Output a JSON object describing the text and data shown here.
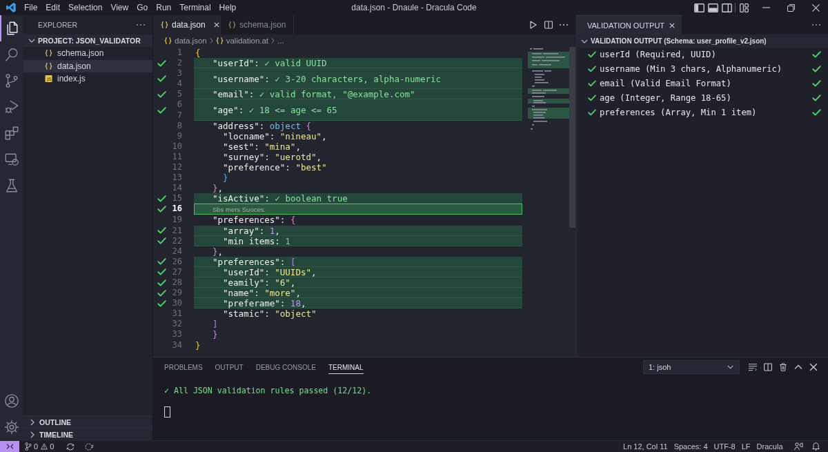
{
  "window": {
    "title": "data.json - Dnaule - Dracula Code"
  },
  "menu": [
    "File",
    "Edit",
    "Selection",
    "View",
    "Go",
    "Run",
    "Terminal",
    "Help"
  ],
  "activity_bar": [
    {
      "kind": "files",
      "selected": true
    },
    {
      "kind": "search",
      "selected": false
    },
    {
      "kind": "source-control",
      "selected": false
    },
    {
      "kind": "run-debug",
      "selected": false
    },
    {
      "kind": "extensions",
      "selected": false
    },
    {
      "kind": "remote",
      "selected": false
    },
    {
      "kind": "testing",
      "selected": false
    }
  ],
  "sidebar": {
    "title": "EXPLORER",
    "project": {
      "label": "PROJECT: JSON_VALIDATOR",
      "expanded": true,
      "files": [
        {
          "name": "schema.json",
          "kind": "json",
          "selected": false
        },
        {
          "name": "data.json",
          "kind": "json",
          "selected": true
        },
        {
          "name": "index.js",
          "kind": "js",
          "selected": false
        }
      ]
    },
    "sections": [
      {
        "label": "OUTLINE",
        "expanded": false
      },
      {
        "label": "TIMELINE",
        "expanded": false
      }
    ]
  },
  "editor": {
    "tabs": [
      {
        "label": "data.json",
        "kind": "json",
        "selected": true
      },
      {
        "label": "schema.json",
        "kind": "json",
        "selected": false
      }
    ],
    "breadcrumb": [
      {
        "label": "data.json",
        "kind": "json"
      },
      {
        "label": "validation.at",
        "kind": "json"
      },
      {
        "label": "...",
        "kind": "more"
      }
    ],
    "lines": [
      {
        "num": [
          "1"
        ],
        "passed": false,
        "highlighted": false,
        "selected": false,
        "tokens": [
          {
            "text": "{",
            "kind": "brace1"
          }
        ],
        "children": [
          {
            "num": [
              "2"
            ],
            "passed": true,
            "highlighted": true,
            "selected": false,
            "tokens": [
              {
                "text": "\"userId\"",
                "kind": "key"
              },
              {
                "text": ": ",
                "kind": "punct"
              },
              {
                "text": "✓ valid UUID",
                "kind": "note"
              }
            ]
          },
          {
            "num": [
              "3",
              "4"
            ],
            "passed": true,
            "highlighted": true,
            "selected": false,
            "tokens": [
              {
                "text": "\"username\"",
                "kind": "key"
              },
              {
                "text": ": ",
                "kind": "punct"
              },
              {
                "text": "✓ 3-20 characters, alpha-numeric",
                "kind": "note"
              }
            ]
          },
          {
            "num": [
              "5"
            ],
            "passed": true,
            "highlighted": true,
            "selected": false,
            "tokens": [
              {
                "text": "\"email\"",
                "kind": "key"
              },
              {
                "text": ": ",
                "kind": "punct"
              },
              {
                "text": "✓ valid format, \"@example.com\"",
                "kind": "note"
              }
            ]
          },
          {
            "num": [
              "6",
              "7"
            ],
            "passed": true,
            "highlighted": true,
            "selected": false,
            "tokens": [
              {
                "text": "\"age\"",
                "kind": "key"
              },
              {
                "text": ": ",
                "kind": "punct"
              },
              {
                "text": "✓ 18 <= age <= 65",
                "kind": "note"
              }
            ]
          },
          {
            "num": [
              "8"
            ],
            "passed": false,
            "highlighted": false,
            "selected": false,
            "tokens": [
              {
                "text": "\"address\"",
                "kind": "key"
              },
              {
                "text": ": ",
                "kind": "punct"
              },
              {
                "text": "object",
                "kind": "type"
              },
              {
                "text": " {",
                "kind": "brace2"
              }
            ],
            "children": [
              {
                "num": [
                  "9"
                ],
                "passed": false,
                "highlighted": false,
                "selected": false,
                "tokens": [
                  {
                    "text": "\"locname\"",
                    "kind": "key"
                  },
                  {
                    "text": ": ",
                    "kind": "punct"
                  },
                  {
                    "text": "\"nineau\"",
                    "kind": "string"
                  },
                  {
                    "text": ",",
                    "kind": "punct"
                  }
                ]
              },
              {
                "num": [
                  "10"
                ],
                "passed": false,
                "highlighted": false,
                "selected": false,
                "tokens": [
                  {
                    "text": "\"sest\"",
                    "kind": "key"
                  },
                  {
                    "text": ": ",
                    "kind": "punct"
                  },
                  {
                    "text": "\"mina\"",
                    "kind": "string"
                  },
                  {
                    "text": ",",
                    "kind": "punct"
                  }
                ]
              },
              {
                "num": [
                  "11"
                ],
                "passed": false,
                "highlighted": false,
                "selected": false,
                "tokens": [
                  {
                    "text": "\"surney\"",
                    "kind": "key"
                  },
                  {
                    "text": ": ",
                    "kind": "punct"
                  },
                  {
                    "text": "\"uerotd\"",
                    "kind": "string"
                  },
                  {
                    "text": ",",
                    "kind": "punct"
                  }
                ]
              },
              {
                "num": [
                  "12"
                ],
                "passed": false,
                "highlighted": false,
                "selected": false,
                "tokens": [
                  {
                    "text": "\"preference\"",
                    "kind": "key"
                  },
                  {
                    "text": ": ",
                    "kind": "punct"
                  },
                  {
                    "text": "\"best\"",
                    "kind": "string"
                  }
                ]
              },
              {
                "num": [
                  "13"
                ],
                "passed": false,
                "highlighted": false,
                "selected": false,
                "tokens": [
                  {
                    "text": "}",
                    "kind": "brace3"
                  }
                ]
              }
            ]
          },
          {
            "num": [
              "14"
            ],
            "passed": false,
            "highlighted": false,
            "selected": false,
            "tokens": [
              {
                "text": "}",
                "kind": "brace2"
              },
              {
                "text": ",",
                "kind": "punct"
              }
            ]
          },
          {
            "num": [
              "15"
            ],
            "passed": true,
            "highlighted": true,
            "selected": false,
            "tokens": [
              {
                "text": "\"isActive\"",
                "kind": "key"
              },
              {
                "text": ": ",
                "kind": "punct"
              },
              {
                "text": "✓ boolean true",
                "kind": "note"
              }
            ]
          },
          {
            "num": [
              "16"
            ],
            "passed": true,
            "highlighted": true,
            "selected": true,
            "tokens": [
              {
                "text": "Sbs mers Suoces.",
                "kind": "comment"
              }
            ]
          },
          {
            "num": [
              "19"
            ],
            "passed": false,
            "highlighted": false,
            "selected": false,
            "tokens": [
              {
                "text": "\"preferences\"",
                "kind": "key"
              },
              {
                "text": ": ",
                "kind": "punct"
              },
              {
                "text": "{",
                "kind": "brace2"
              }
            ],
            "children": [
              {
                "num": [
                  "21"
                ],
                "passed": true,
                "highlighted": true,
                "selected": false,
                "tokens": [
                  {
                    "text": "\"array\"",
                    "kind": "key"
                  },
                  {
                    "text": ": ",
                    "kind": "punct"
                  },
                  {
                    "text": "1",
                    "kind": "number"
                  },
                  {
                    "text": ",",
                    "kind": "punct"
                  }
                ]
              },
              {
                "num": [
                  "22"
                ],
                "passed": true,
                "highlighted": true,
                "selected": false,
                "tokens": [
                  {
                    "text": "\"min items",
                    "kind": "key"
                  },
                  {
                    "text": ": ",
                    "kind": "punct"
                  },
                  {
                    "text": "1",
                    "kind": "number"
                  }
                ]
              }
            ]
          },
          {
            "num": [
              "24"
            ],
            "passed": false,
            "highlighted": false,
            "selected": false,
            "tokens": [
              {
                "text": "}",
                "kind": "brace2"
              },
              {
                "text": ",",
                "kind": "punct"
              }
            ]
          },
          {
            "num": [
              "26"
            ],
            "passed": true,
            "highlighted": true,
            "selected": false,
            "tokens": [
              {
                "text": "\"preferences\"",
                "kind": "key"
              },
              {
                "text": ": ",
                "kind": "punct"
              },
              {
                "text": "[",
                "kind": "brace4"
              }
            ],
            "children": [
              {
                "num": [
                  "27"
                ],
                "passed": true,
                "highlighted": true,
                "selected": false,
                "tokens": [
                  {
                    "text": "\"userId\"",
                    "kind": "key"
                  },
                  {
                    "text": ": ",
                    "kind": "punct"
                  },
                  {
                    "text": "\"UUIDs\"",
                    "kind": "string"
                  },
                  {
                    "text": ",",
                    "kind": "punct"
                  }
                ]
              },
              {
                "num": [
                  "28"
                ],
                "passed": true,
                "highlighted": true,
                "selected": false,
                "tokens": [
                  {
                    "text": "\"eamily\"",
                    "kind": "key"
                  },
                  {
                    "text": ": ",
                    "kind": "punct"
                  },
                  {
                    "text": "\"6\"",
                    "kind": "string"
                  },
                  {
                    "text": ",",
                    "kind": "punct"
                  }
                ]
              },
              {
                "num": [
                  "29"
                ],
                "passed": true,
                "highlighted": true,
                "selected": false,
                "tokens": [
                  {
                    "text": "\"name\"",
                    "kind": "key"
                  },
                  {
                    "text": ": ",
                    "kind": "punct"
                  },
                  {
                    "text": "\"more\"",
                    "kind": "string"
                  },
                  {
                    "text": ",",
                    "kind": "punct"
                  }
                ]
              },
              {
                "num": [
                  "30"
                ],
                "passed": true,
                "highlighted": true,
                "selected": false,
                "tokens": [
                  {
                    "text": "\"preferame\"",
                    "kind": "key"
                  },
                  {
                    "text": ": ",
                    "kind": "punct"
                  },
                  {
                    "text": "18",
                    "kind": "number"
                  },
                  {
                    "text": ",",
                    "kind": "punct"
                  }
                ]
              },
              {
                "num": [
                  "31"
                ],
                "passed": false,
                "highlighted": false,
                "selected": false,
                "tokens": [
                  {
                    "text": "\"stamic\"",
                    "kind": "key"
                  },
                  {
                    "text": ": ",
                    "kind": "punct"
                  },
                  {
                    "text": "\"object\"",
                    "kind": "string"
                  }
                ]
              }
            ]
          },
          {
            "num": [
              "32"
            ],
            "passed": false,
            "highlighted": false,
            "selected": false,
            "tokens": [
              {
                "text": "]",
                "kind": "brace4"
              }
            ]
          },
          {
            "num": [
              "33"
            ],
            "passed": false,
            "highlighted": false,
            "selected": false,
            "tokens": [
              {
                "text": "}",
                "kind": "brace2"
              }
            ]
          }
        ]
      },
      {
        "num": [
          "34"
        ],
        "passed": false,
        "highlighted": false,
        "selected": false,
        "tokens": [
          {
            "text": "}",
            "kind": "brace1"
          }
        ]
      }
    ]
  },
  "validation_panel": {
    "tab": "VALIDATION OUTPUT",
    "header": "VALIDATION OUTPUT (Schema: user_profile_v2.json)",
    "expanded": true,
    "rules": [
      {
        "text": "userId (Required, UUID)",
        "passed": true
      },
      {
        "text": "username (Min 3 chars, Alphanumeric)",
        "passed": true
      },
      {
        "text": "email (Valid Email Format)",
        "passed": true
      },
      {
        "text": "age (Integer, Range 18-65)",
        "passed": true
      },
      {
        "text": "preferences (Array, Min 1 item)",
        "passed": true
      }
    ]
  },
  "bottom_panel": {
    "tabs": [
      {
        "label": "PROBLEMS",
        "selected": false
      },
      {
        "label": "OUTPUT",
        "selected": false
      },
      {
        "label": "DEBUG CONSOLE",
        "selected": false
      },
      {
        "label": "TERMINAL",
        "selected": true
      }
    ],
    "terminal_select": "1: jsoh",
    "output": [
      "✓ All JSON validation rules passed (12/12)."
    ]
  },
  "status_bar": {
    "counts": [
      "0",
      "0"
    ],
    "items": [
      "Ln 12, Col 11",
      "Spaces: 4",
      "UTF-8",
      "LF",
      "Dracula"
    ]
  }
}
